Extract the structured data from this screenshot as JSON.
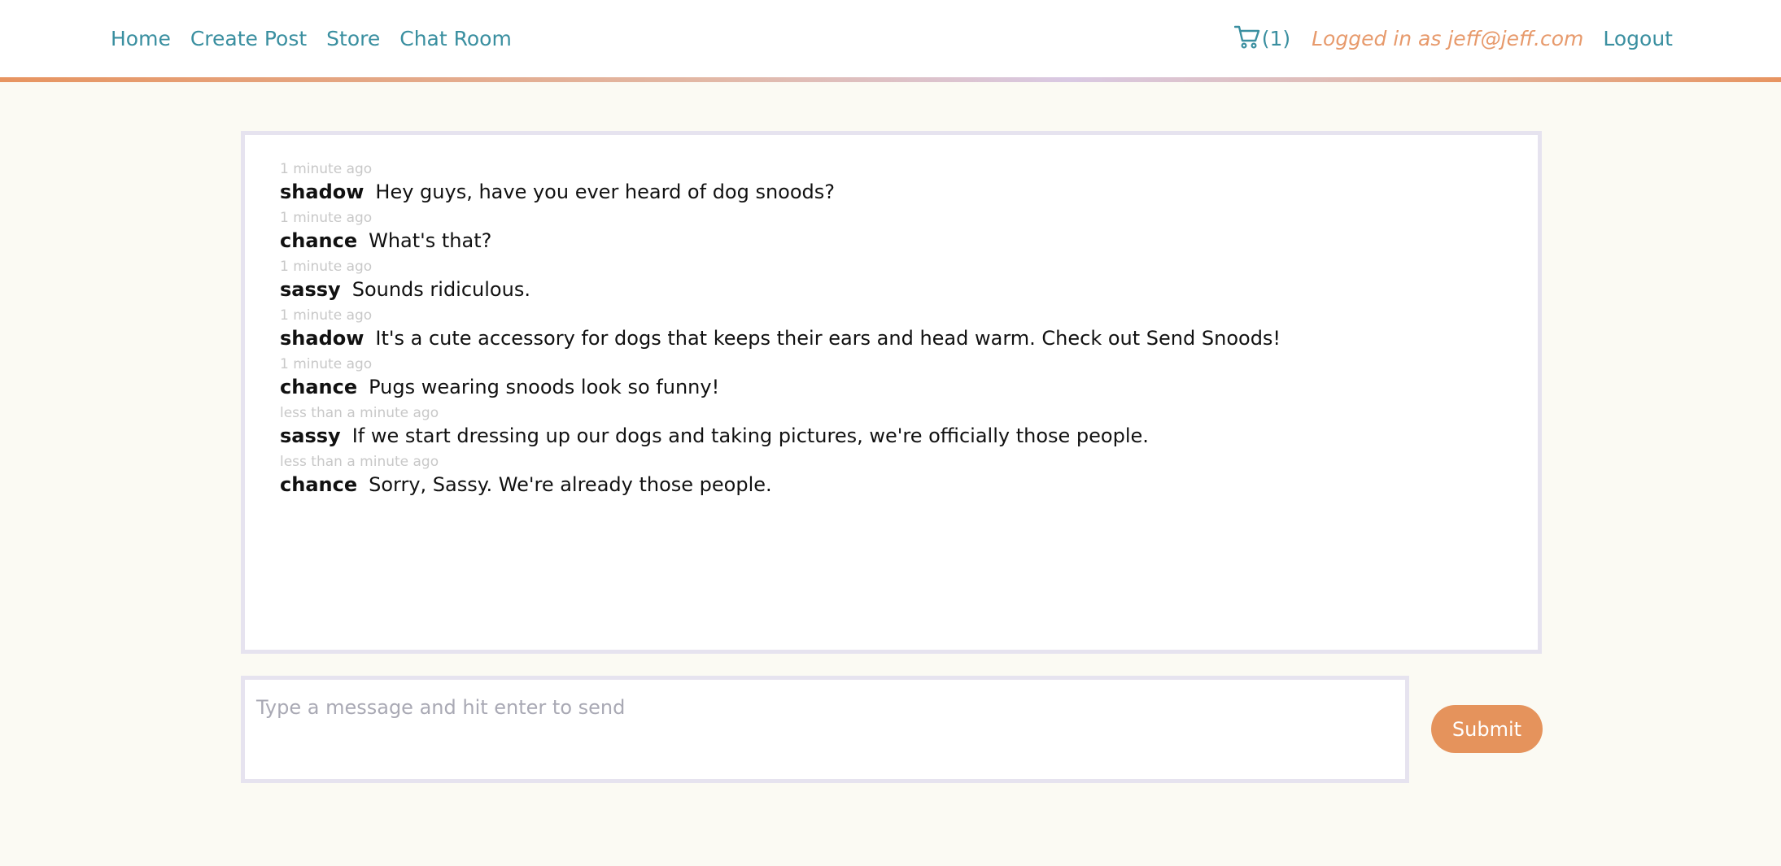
{
  "nav": {
    "links": [
      "Home",
      "Create Post",
      "Store",
      "Chat Room"
    ],
    "cart_count": "(1)",
    "logged_in_text": "Logged in as jeff@jeff.com",
    "logout_label": "Logout",
    "cart_icon": "shopping-cart-icon"
  },
  "chat": {
    "messages": [
      {
        "time": "1 minute ago",
        "user": "shadow",
        "text": "Hey guys, have you ever heard of dog snoods?"
      },
      {
        "time": "1 minute ago",
        "user": "chance",
        "text": "What's that?"
      },
      {
        "time": "1 minute ago",
        "user": "sassy",
        "text": "Sounds ridiculous."
      },
      {
        "time": "1 minute ago",
        "user": "shadow",
        "text": "It's a cute accessory for dogs that keeps their ears and head warm. Check out Send Snoods!"
      },
      {
        "time": "1 minute ago",
        "user": "chance",
        "text": "Pugs wearing snoods look so funny!"
      },
      {
        "time": "less than a minute ago",
        "user": "sassy",
        "text": "If we start dressing up our dogs and taking pictures, we're officially those people."
      },
      {
        "time": "less than a minute ago",
        "user": "chance",
        "text": "Sorry, Sassy. We're already those people."
      }
    ]
  },
  "composer": {
    "placeholder": "Type a message and hit enter to send",
    "value": "",
    "submit_label": "Submit"
  },
  "colors": {
    "link": "#3a8fa0",
    "accent": "#e5935c",
    "border": "#e6e3ef",
    "background": "#fbfaf3"
  }
}
